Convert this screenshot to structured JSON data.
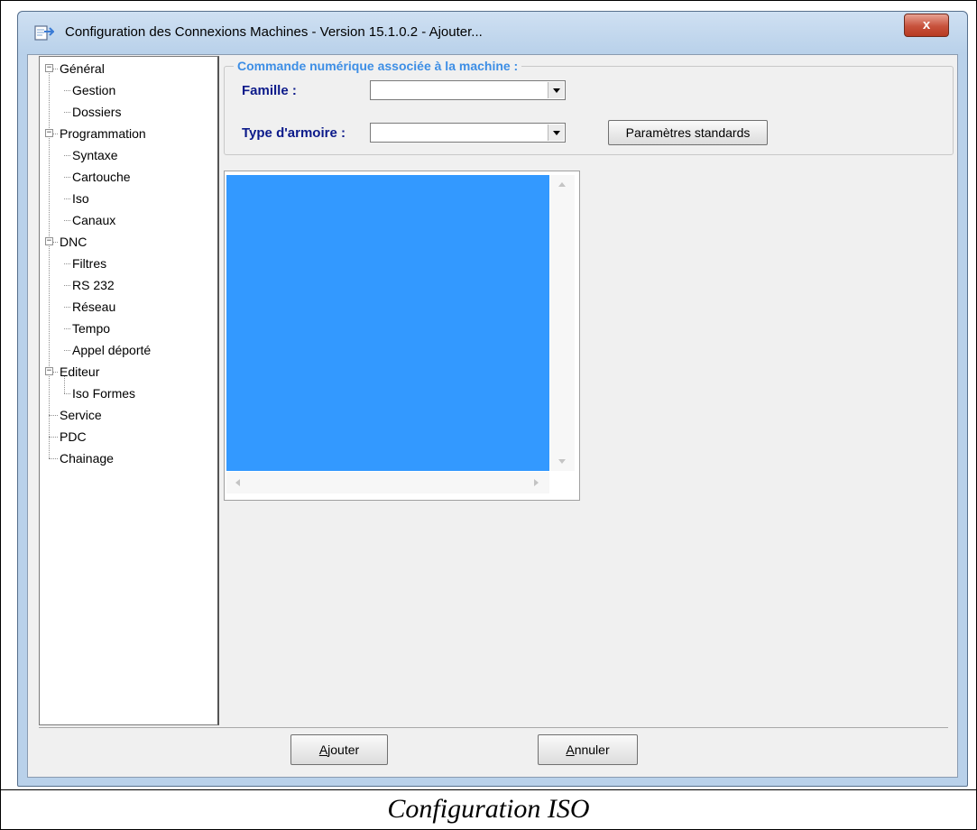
{
  "window": {
    "title": "Configuration des Connexions Machines - Version 15.1.0.2 - Ajouter...",
    "close_label": "x"
  },
  "tree": {
    "nodes": [
      {
        "label": "Général",
        "level": 0,
        "expander": "⊟"
      },
      {
        "label": "Gestion",
        "level": 1
      },
      {
        "label": "Dossiers",
        "level": 1
      },
      {
        "label": "Programmation",
        "level": 0,
        "expander": "⊟"
      },
      {
        "label": "Syntaxe",
        "level": 1
      },
      {
        "label": "Cartouche",
        "level": 1
      },
      {
        "label": "Iso",
        "level": 1
      },
      {
        "label": "Canaux",
        "level": 1
      },
      {
        "label": "DNC",
        "level": 0,
        "expander": "⊟"
      },
      {
        "label": "Filtres",
        "level": 1
      },
      {
        "label": "RS 232",
        "level": 1
      },
      {
        "label": "Réseau",
        "level": 1
      },
      {
        "label": "Tempo",
        "level": 1
      },
      {
        "label": "Appel déporté",
        "level": 1
      },
      {
        "label": "Editeur",
        "level": 0,
        "expander": "⊟"
      },
      {
        "label": "Iso Formes",
        "level": 1
      },
      {
        "label": "Service",
        "level": 0
      },
      {
        "label": "PDC",
        "level": 0
      },
      {
        "label": "Chainage",
        "level": 0
      }
    ]
  },
  "group": {
    "legend": "Commande numérique associée à la machine :",
    "famille_label": "Famille :",
    "famille_value": "",
    "type_label": "Type d'armoire :",
    "type_value": "",
    "standard_button": "Paramètres standards"
  },
  "buttons": {
    "ajouter_first": "A",
    "ajouter_rest": "jouter",
    "annuler_first": "A",
    "annuler_rest": "nnuler"
  },
  "caption": "Configuration ISO",
  "colors": {
    "list_selection": "#3399ff",
    "legend_text": "#3d8ee5",
    "label_text": "#0c1a8a"
  }
}
